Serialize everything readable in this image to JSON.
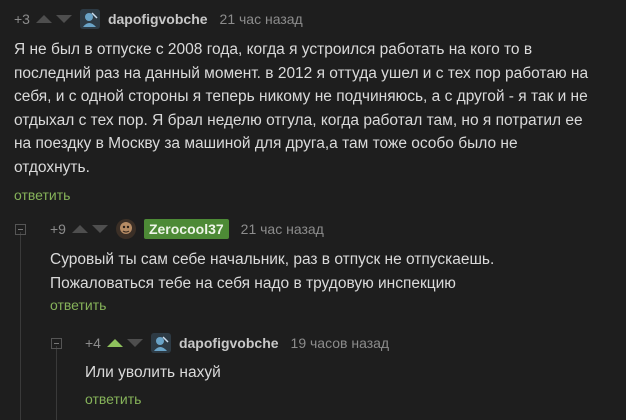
{
  "comments": [
    {
      "rating": "+3",
      "author": "dapofigvobche",
      "time": "21 час назад",
      "lines": [
        "Я не был в отпуске с 2008 года, когда я устроился работать на кого то в",
        "последний раз на данный момент. в 2012 я оттуда ушел и с тех пор работаю на",
        "себя, и с одной стороны я теперь никому не подчиняюсь, а с другой - я так и не",
        "отдыхал с тех пор. Я брал неделю отгула, когда работал там, но я потратил ее",
        "на поездку в Москву за машиной для друга,а там тоже особо было не",
        "отдохнуть."
      ],
      "reply_label": "ответить"
    },
    {
      "rating": "+9",
      "author": "Zerocool37",
      "time": "21 час назад",
      "lines": [
        "Суровый ты сам себе начальник, раз в отпуск не отпускаешь.",
        "Пожаловаться тебе на себя надо в трудовую инспекцию"
      ],
      "reply_label": "ответить"
    },
    {
      "rating": "+4",
      "author": "dapofigvobche",
      "time": "19 часов назад",
      "lines": [
        "Или уволить нахуй"
      ],
      "reply_label": "ответить"
    }
  ],
  "colors": {
    "background": "#1e1e1e",
    "accent_green": "#86b35a",
    "badge_green": "#4d8a36"
  },
  "icons": [
    "arrow-up-icon",
    "arrow-down-icon",
    "collapse-icon"
  ]
}
